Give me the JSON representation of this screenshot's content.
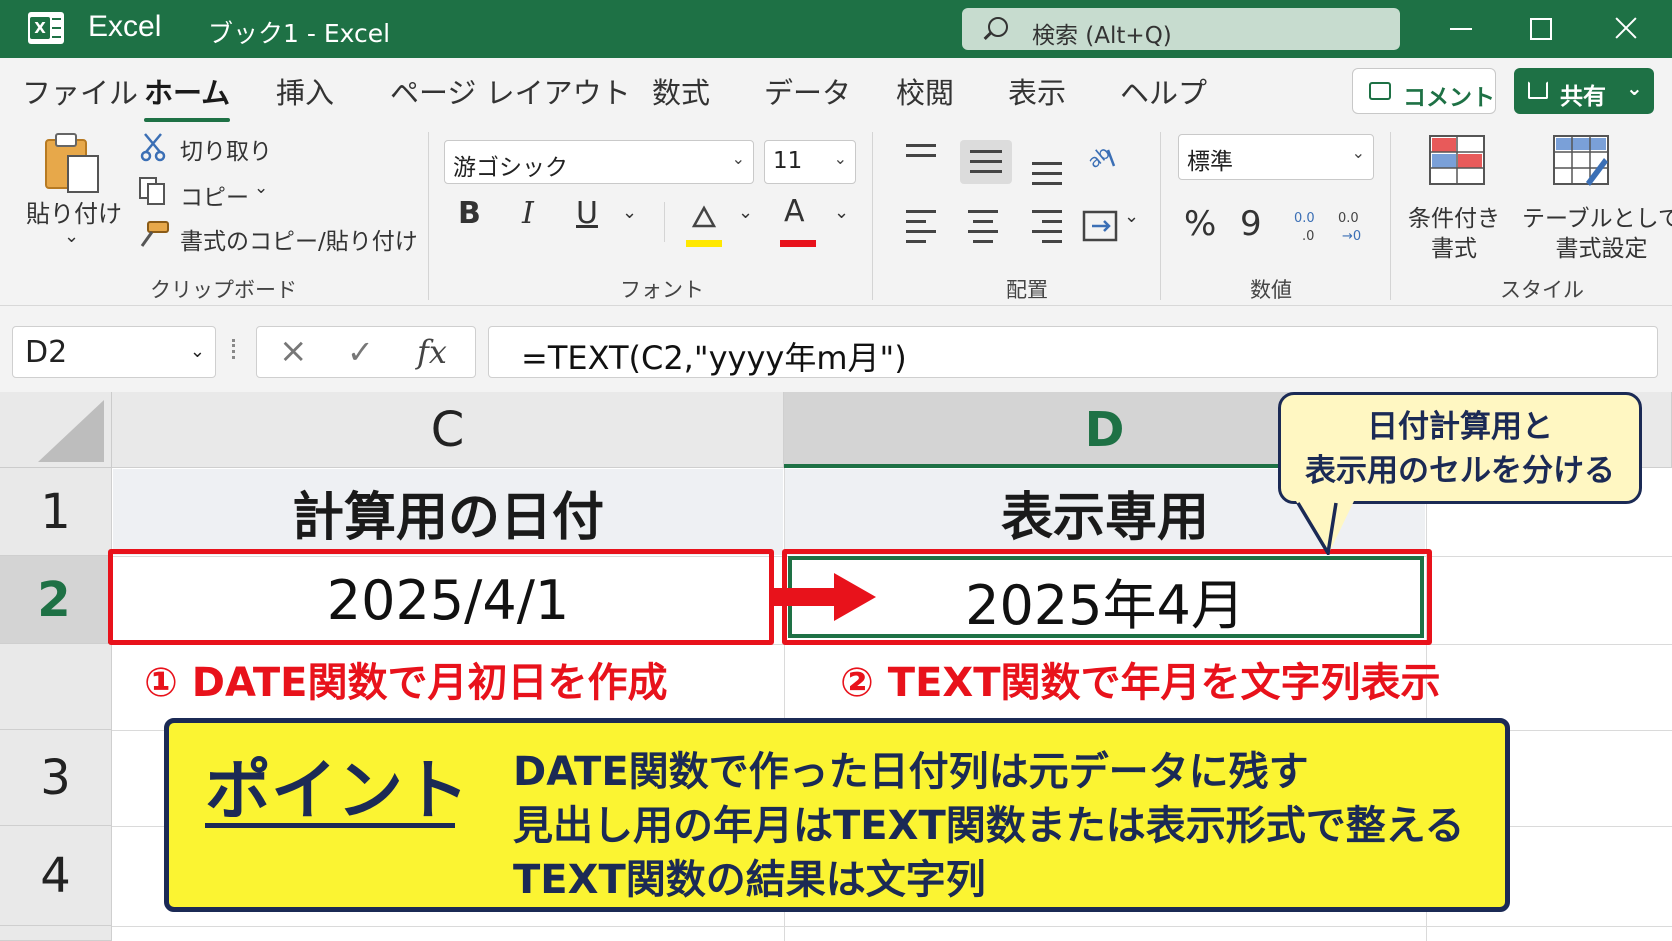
{
  "titlebar": {
    "app_name": "Excel",
    "document_title": "ブック1  -  Excel",
    "search_placeholder": "検索 (Alt+Q)"
  },
  "ribbon_tabs": [
    {
      "label": "ファイル",
      "active": false
    },
    {
      "label": "ホーム",
      "active": true
    },
    {
      "label": "挿入",
      "active": false
    },
    {
      "label": "ページ レイアウト",
      "active": false
    },
    {
      "label": "数式",
      "active": false
    },
    {
      "label": "データ",
      "active": false
    },
    {
      "label": "校閲",
      "active": false
    },
    {
      "label": "表示",
      "active": false
    },
    {
      "label": "ヘルプ",
      "active": false
    }
  ],
  "ribbon_actions": {
    "comment": "コメント",
    "share": "共有"
  },
  "clipboard": {
    "paste": "貼り付け",
    "cut": "切り取り",
    "copy": "コピー",
    "format_painter": "書式のコピー/貼り付け",
    "group_label": "クリップボード"
  },
  "font": {
    "font_name": "游ゴシック",
    "font_size": "11",
    "bold": "B",
    "italic": "I",
    "underline": "U",
    "font_color_glyph": "A",
    "group_label": "フォント",
    "highlight_color": "#ffe800",
    "font_color": "#e8121b"
  },
  "alignment": {
    "group_label": "配置"
  },
  "number": {
    "format": "標準",
    "percent": "%",
    "comma": "9",
    "group_label": "数値"
  },
  "styles": {
    "conditional_format": "条件付き\n書式",
    "format_as_table": "テーブルとして\n書式設定",
    "group_label": "スタイル"
  },
  "formula_bar": {
    "name_box": "D2",
    "formula": "=TEXT(C2,\"yyyy年m月\")"
  },
  "sheet": {
    "columns": [
      "C",
      "D"
    ],
    "selected_column": "D",
    "rows": [
      "1",
      "2",
      "",
      "3",
      "4"
    ],
    "selected_row": "2",
    "header_c": "計算用の日付",
    "header_d": "表示専用",
    "value_c2": "2025/4/1",
    "value_d2": "2025年4月"
  },
  "annotations": {
    "label_1": "① DATE関数で月初日を作成",
    "label_2": "② TEXT関数で年月を文字列表示",
    "callout": "日付計算用と\n表示用のセルを分ける",
    "point_title": "ポイント",
    "point_lines": [
      "DATE関数で作った日付列は元データに残す",
      "見出し用の年月はTEXT関数または表示形式で整える",
      "TEXT関数の結果は文字列"
    ],
    "accent_red": "#e8121b",
    "accent_yellow": "#fbf432",
    "navy": "#1b2a55",
    "excel_green": "#1e7145"
  }
}
